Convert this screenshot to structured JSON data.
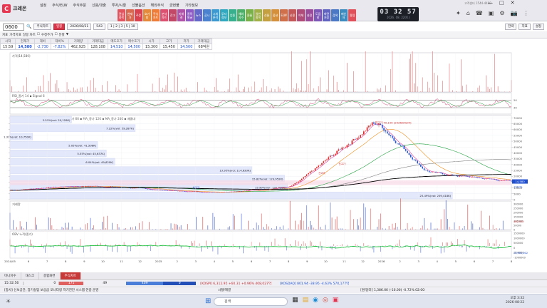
{
  "app": {
    "name": "크레온",
    "helpdesk": "고객센터 1544-4488"
  },
  "menus": [
    "설정",
    "주식/ELW",
    "주식주문",
    "신용/대출",
    "투자/시황",
    "선물옵션",
    "해외주식",
    "금현물",
    "기타정보"
  ],
  "toolbar_buttons": [
    {
      "label": "관심\n종목",
      "color": "#e05560"
    },
    {
      "label": "현재\n가",
      "color": "#d96a52"
    },
    {
      "label": "주문",
      "color": "#d9434f"
    },
    {
      "label": "호가\n창",
      "color": "#e48a3a"
    },
    {
      "label": "주식\n차트",
      "color": "#ef7d3a"
    },
    {
      "label": "분석\n차트",
      "color": "#dc5070"
    },
    {
      "label": "잔고",
      "color": "#c24868"
    },
    {
      "label": "미체\n결",
      "color": "#b052a8"
    },
    {
      "label": "종목\n발굴",
      "color": "#8e5bc4"
    },
    {
      "label": "뉴스",
      "color": "#6468c8"
    },
    {
      "label": "공시",
      "color": "#4a82d0"
    },
    {
      "label": "시세\n분석",
      "color": "#3c9ad0"
    },
    {
      "label": "투자\n정보",
      "color": "#30a8c0"
    },
    {
      "label": "업종",
      "color": "#38b08e"
    },
    {
      "label": "해외\n지수",
      "color": "#4cb06a"
    },
    {
      "label": "환율",
      "color": "#7ab04a"
    },
    {
      "label": "일반\n종목",
      "color": "#a2b048"
    },
    {
      "label": "선물",
      "color": "#c4a040"
    },
    {
      "label": "옵션",
      "color": "#d4903a"
    },
    {
      "label": "ELW",
      "color": "#d0704a"
    },
    {
      "label": "신용",
      "color": "#c45858"
    },
    {
      "label": "이체",
      "color": "#b04c7a"
    },
    {
      "label": "설정",
      "color": "#9a4c9a"
    },
    {
      "label": "도움\n말",
      "color": "#7e58b8"
    },
    {
      "label": "화면\n저장",
      "color": "#6064c0"
    },
    {
      "label": "검색",
      "color": "#4a78c4"
    },
    {
      "label": "메신\n저",
      "color": "#3c8cc0"
    },
    {
      "label": "알림",
      "color": "#e0505a"
    }
  ],
  "clock": {
    "time": "03 32 57",
    "date": "2026. 08. 22(토)"
  },
  "right_icons": [
    "✦",
    "⌂",
    "☎",
    "▣",
    "⚙",
    "📷",
    "⋮"
  ],
  "codebar": {
    "code": "0600",
    "account_select": "주식차트",
    "period_tab": "일봉",
    "date": "2026/08/21",
    "count": "543",
    "chart_period": "1 | 2 | 3 | 5 | 10",
    "buttons": [
      "전략",
      "지표",
      "설정"
    ]
  },
  "toolbar2": [
    "지표",
    "가격지표",
    "일봉 차트",
    "☐",
    "수정주가",
    "☐",
    "분할",
    "▼"
  ],
  "quote": {
    "headers": [
      "시작",
      "현재가",
      "대비",
      "대비%",
      "거래량",
      "거래대금",
      "매도호가",
      "매수호가",
      "시가",
      "고가",
      "저가",
      "거래대금"
    ],
    "values": [
      "15:59",
      "14,580",
      "-2,730",
      "-7.82%",
      "462,925",
      "128,108",
      "14,510",
      "14,500",
      "15,300",
      "15,450",
      "14,500",
      "68억원"
    ],
    "colors": [
      "#333",
      "#1a4fd6",
      "#1a4fd6",
      "#1a4fd6",
      "#333",
      "#333",
      "#1a4fd6",
      "#1a4fd6",
      "#333",
      "#333",
      "#1a4fd6",
      "#333"
    ]
  },
  "chart": {
    "price_axis_ticks": [
      "70000",
      "65000",
      "60000",
      "55000",
      "50000",
      "45000",
      "40000",
      "35000",
      "30000",
      "25000",
      "20000",
      "15000",
      "10000",
      "5000",
      "0"
    ],
    "date_ticks": [
      "2024/05",
      "6",
      "7",
      "8",
      "9",
      "10",
      "11",
      "12",
      "2025",
      "2",
      "3",
      "4",
      "5",
      "6",
      "7",
      "8",
      "9",
      "10",
      "11",
      "12",
      "2026",
      "2",
      "3",
      "4",
      "5",
      "6",
      "7",
      "8"
    ],
    "volume_ticks": [
      "300000",
      "250000",
      "200000",
      "150000",
      "100000",
      "50000",
      "0"
    ],
    "obv_ticks": [
      "1500000",
      "1000000",
      "500000",
      "0",
      "-500000",
      "-1000000"
    ],
    "rsi_ticks": [
      "50",
      "30"
    ],
    "panels": {
      "p1": "가격(14,580)",
      "p2": "RSI_종가 14 ▪ Signal 6",
      "p3": "일봉차트 MA_종가 5 ▪ MA_종가 20 ▪ MA_종가 60 ▪ MA_종가 120 ▪ MA_종가 240 ▪ 매물대",
      "p4": "거래량",
      "p5": "OBV 누적(종가)"
    },
    "volume_profile": [
      {
        "label": "3.55%(vol: 29,128K)",
        "pct": 0.355
      },
      {
        "label": "7.22%(vol: 59,287K)",
        "pct": 0.722
      },
      {
        "label": "1.31%(vol: 10,750K)",
        "pct": 0.131
      },
      {
        "label": "5.05%(vol: 41,508K)",
        "pct": 0.505
      },
      {
        "label": "5.55%(vol: 45,637K)",
        "pct": 0.555
      },
      {
        "label": "6.04%(vol: 49,620K)",
        "pct": 0.604
      },
      {
        "label": "13.95%(vol: 114,633K)",
        "pct": 1.395
      },
      {
        "label": "15.82%(vol: 129,952K)",
        "pct": 1.582
      },
      {
        "label": "15.99%(vol: 131,325K)",
        "pct": 1.599
      },
      {
        "label": "25.49%(vol: 209,418K)",
        "pct": 2.549
      }
    ],
    "annotations": {
      "max": "최고가 70,100 (2026/05/04)",
      "min": "최저가",
      "last_price": "14,580",
      "last_change": "-7.82%",
      "volume_last": "462,925",
      "obv_last": "25,900,002"
    },
    "markers": [
      "최저가",
      "신고가",
      "신고가"
    ]
  },
  "tabs": [
    "미니지수",
    "대스크",
    "종합화면",
    "주식차트"
  ],
  "active_tab": "주식차트",
  "status": {
    "time": "15:32:56",
    "value1": "0",
    "value2": "171",
    "value3": "49",
    "value4": "409",
    "value5": "0",
    "kospi": "[KOSPI] 6,312.95 +60.31 +0.96% 408,027억",
    "kosdaq": "[KOSDAQ] 801.94 -38.95 -4.63% 570,177억",
    "ticker": "[종사] 신보공단, 장기실업 보상금 모니터링 자기진단 시스템 연중 운영",
    "mode": "시황/해결",
    "fx": "[원/달러] 1,386.00 (-10.00) -0.72% 02:00"
  },
  "taskbar": {
    "search": "검색",
    "time": "오후 3:32",
    "date": "2026-08-22"
  }
}
